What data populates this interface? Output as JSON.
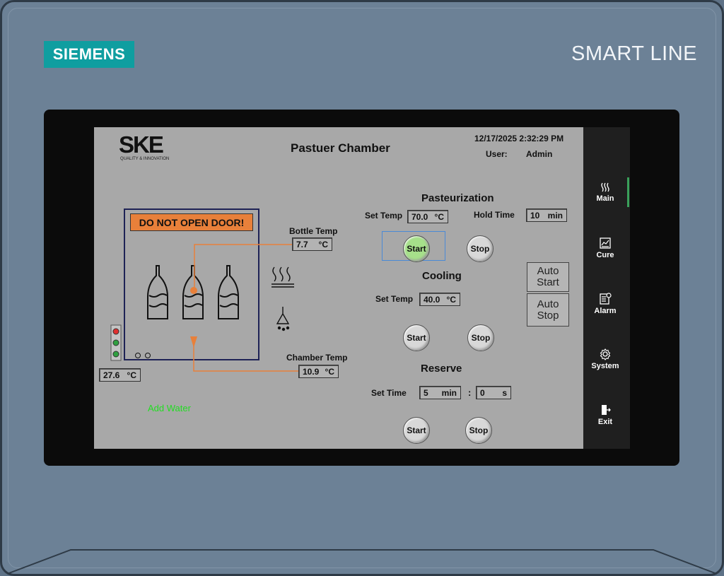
{
  "device": {
    "brand": "SIEMENS",
    "series": "SMART LINE"
  },
  "header": {
    "logo_text": "SKE",
    "logo_tagline": "QUALITY & INNOVATION",
    "title": "Pastuer Chamber",
    "datetime": "12/17/2025 2:32:29 PM",
    "user_label": "User:",
    "user_value": "Admin"
  },
  "chamber": {
    "warning": "DO NOT OPEN DOOR!",
    "bottle_temp_label": "Bottle Temp",
    "bottle_temp_value": "7.7",
    "bottle_temp_unit": "°C",
    "chamber_temp_label": "Chamber Temp",
    "chamber_temp_value": "10.9",
    "chamber_temp_unit": "°C",
    "ambient_value": "27.6",
    "ambient_unit": "°C",
    "add_water": "Add Water"
  },
  "pasteurization": {
    "title": "Pasteurization",
    "set_temp_label": "Set Temp",
    "set_temp_value": "70.0",
    "set_temp_unit": "°C",
    "hold_time_label": "Hold Time",
    "hold_time_value": "10",
    "hold_time_unit": "min",
    "start": "Start",
    "stop": "Stop"
  },
  "cooling": {
    "title": "Cooling",
    "set_temp_label": "Set Temp",
    "set_temp_value": "40.0",
    "set_temp_unit": "°C",
    "start": "Start",
    "stop": "Stop"
  },
  "auto": {
    "start_line1": "Auto",
    "start_line2": "Start",
    "stop_line1": "Auto",
    "stop_line2": "Stop"
  },
  "reserve": {
    "title": "Reserve",
    "set_time_label": "Set Time",
    "min_value": "5",
    "min_unit": "min",
    "separator": ":",
    "sec_value": "0",
    "sec_unit": "s",
    "start": "Start",
    "stop": "Stop"
  },
  "nav": {
    "items": [
      {
        "label": "Main",
        "icon": "heat-icon"
      },
      {
        "label": "Cure",
        "icon": "chart-icon"
      },
      {
        "label": "Alarm",
        "icon": "alarm-list-icon"
      },
      {
        "label": "System",
        "icon": "gear-icon"
      },
      {
        "label": "Exit",
        "icon": "exit-icon"
      }
    ]
  },
  "colors": {
    "accent_orange": "#e8803a",
    "screen_bg": "#a8a8a8",
    "active_green": "#a6e08a",
    "add_water_green": "#22dd22"
  }
}
